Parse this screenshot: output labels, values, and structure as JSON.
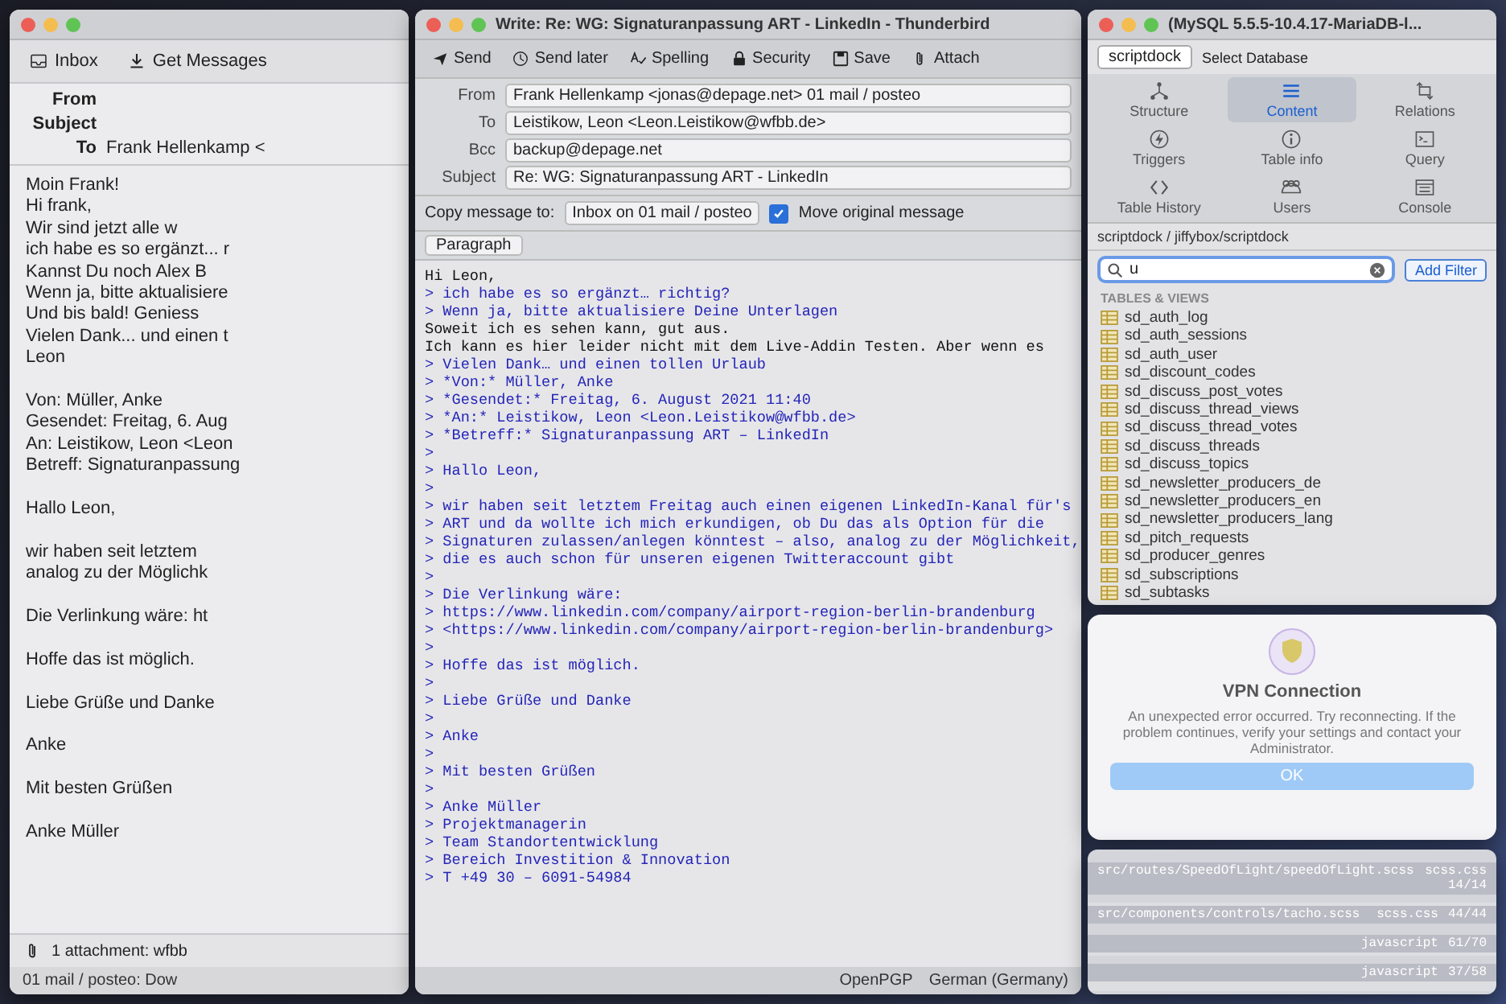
{
  "reader": {
    "toolbar": [
      {
        "label": "Inbox",
        "kind": "inbox"
      },
      {
        "label": "Get Messages",
        "kind": "get"
      }
    ],
    "headers": [
      {
        "label": "From"
      },
      {
        "label": "Subject"
      },
      {
        "label": "To",
        "value": "Frank Hellenkamp <"
      }
    ],
    "paragraphs": [
      [
        "Moin Frank!",
        "Hi frank,",
        "Wir sind jetzt alle w",
        "ich habe es so ergänzt... r",
        "Kannst Du noch Alex B",
        "Wenn ja, bitte aktualisiere",
        "Und bis bald! Geniess",
        "Vielen Dank... und einen t",
        "Leon"
      ],
      [
        "Von: Müller, Anke",
        "Gesendet: Freitag, 6. Aug",
        "An: Leistikow, Leon <Leon",
        "Betreff: Signaturanpassung"
      ],
      [
        "Hallo Leon,"
      ],
      [
        "wir haben seit letztem",
        "analog zu der Möglichk"
      ],
      [
        "Die Verlinkung wäre: ht"
      ],
      [
        "Hoffe das ist möglich."
      ],
      [
        "Liebe Grüße und Danke"
      ],
      [
        "Anke"
      ],
      [
        "Mit besten Grüßen"
      ],
      [
        "Anke Müller"
      ]
    ],
    "attachment": "1 attachment: wfbb",
    "status": "01 mail / posteo: Dow"
  },
  "compose": {
    "title": "Write: Re: WG: Signaturanpassung ART - LinkedIn - Thunderbird",
    "toolbar": [
      {
        "label": "Send",
        "kind": "send"
      },
      {
        "label": "Send later",
        "kind": "later"
      },
      {
        "label": "Spelling",
        "kind": "spelling"
      },
      {
        "label": "Security",
        "kind": "security"
      },
      {
        "label": "Save",
        "kind": "save"
      },
      {
        "label": "Attach",
        "kind": "attach"
      }
    ],
    "fields": [
      {
        "label": "From",
        "value": "Frank Hellenkamp <jonas@depage.net> 01 mail / posteo"
      },
      {
        "label": "To",
        "value": "Leistikow, Leon <Leon.Leistikow@wfbb.de>"
      },
      {
        "label": "Bcc",
        "value": "backup@depage.net"
      },
      {
        "label": "Subject",
        "value": "Re: WG: Signaturanpassung ART - LinkedIn"
      }
    ],
    "copy": {
      "label": "Copy message to:",
      "value": "Inbox on 01 mail / posteo",
      "option": "Move original message",
      "checked": true
    },
    "format": "Paragraph",
    "body": [
      {
        "kind": "text",
        "text": "Hi Leon,"
      },
      {
        "kind": "quote",
        "text": "> ich habe es so ergänzt… richtig?"
      },
      {
        "kind": "quote",
        "text": "> Wenn ja, bitte aktualisiere Deine Unterlagen"
      },
      {
        "kind": "text",
        "text": "Soweit ich es sehen kann, gut aus."
      },
      {
        "kind": "text",
        "text": "Ich kann es hier leider nicht mit dem Live-Addin Testen. Aber wenn es"
      },
      {
        "kind": "quote",
        "text": "> Vielen Dank… und einen tollen Urlaub"
      },
      {
        "kind": "quote",
        "text": "> *Von:* Müller, Anke"
      },
      {
        "kind": "quote",
        "text": "> *Gesendet:* Freitag, 6. August 2021 11:40"
      },
      {
        "kind": "quote",
        "text": "> *An:* Leistikow, Leon <Leon.Leistikow@wfbb.de>"
      },
      {
        "kind": "quote",
        "text": "> *Betreff:* Signaturanpassung ART – LinkedIn"
      },
      {
        "kind": "quote",
        "text": ">"
      },
      {
        "kind": "quote",
        "text": "> Hallo Leon,"
      },
      {
        "kind": "quote",
        "text": ">"
      },
      {
        "kind": "quote",
        "text": "> wir haben seit letztem Freitag auch einen eigenen LinkedIn-Kanal für's"
      },
      {
        "kind": "quote",
        "text": "> ART und da wollte ich mich erkundigen, ob Du das als Option für die"
      },
      {
        "kind": "quote",
        "text": "> Signaturen zulassen/anlegen könntest – also, analog zu der Möglichkeit,"
      },
      {
        "kind": "quote",
        "text": "> die es auch schon für unseren eigenen Twitteraccount gibt"
      },
      {
        "kind": "quote",
        "text": ">"
      },
      {
        "kind": "quote",
        "text": "> Die Verlinkung wäre:"
      },
      {
        "kind": "quote",
        "text": "> https://www.linkedin.com/company/airport-region-berlin-brandenburg"
      },
      {
        "kind": "quote",
        "text": "> <https://www.linkedin.com/company/airport-region-berlin-brandenburg>"
      },
      {
        "kind": "quote",
        "text": ">"
      },
      {
        "kind": "quote",
        "text": "> Hoffe das ist möglich."
      },
      {
        "kind": "quote",
        "text": ">"
      },
      {
        "kind": "quote",
        "text": "> Liebe Grüße und Danke"
      },
      {
        "kind": "quote",
        "text": ">"
      },
      {
        "kind": "quote",
        "text": "> Anke"
      },
      {
        "kind": "quote",
        "text": ">"
      },
      {
        "kind": "quote",
        "text": "> Mit besten Grüßen"
      },
      {
        "kind": "quote",
        "text": ">"
      },
      {
        "kind": "quote",
        "text": "> Anke Müller"
      },
      {
        "kind": "quote",
        "text": "> Projektmanagerin"
      },
      {
        "kind": "quote",
        "text": "> Team Standortentwicklung"
      },
      {
        "kind": "quote",
        "text": "> Bereich Investition & Innovation"
      },
      {
        "kind": "quote",
        "text": "> T +49 30 – 6091-54984"
      }
    ],
    "status": [
      "OpenPGP",
      "German (Germany)"
    ]
  },
  "sequel": {
    "title": "(MySQL 5.5.5-10.4.17-MariaDB-l...",
    "database": "scriptdock",
    "database_label": "Select Database",
    "toolbar": [
      {
        "label": "Structure",
        "kind": "structure",
        "selected": false
      },
      {
        "label": "Content",
        "kind": "content",
        "selected": true
      },
      {
        "label": "Relations",
        "kind": "relations",
        "selected": false
      },
      {
        "label": "Triggers",
        "kind": "triggers",
        "selected": false
      },
      {
        "label": "Table info",
        "kind": "info",
        "selected": false
      },
      {
        "label": "Query",
        "kind": "query",
        "selected": false
      },
      {
        "label": "Table History",
        "kind": "history",
        "selected": false
      },
      {
        "label": "Users",
        "kind": "users",
        "selected": false
      },
      {
        "label": "Console",
        "kind": "console",
        "selected": false
      }
    ],
    "path": "scriptdock / jiffybox/scriptdock",
    "search": "u",
    "filter_button": "Add Filter",
    "tables_heading": "TABLES & VIEWS",
    "tables": [
      "sd_auth_log",
      "sd_auth_sessions",
      "sd_auth_user",
      "sd_discount_codes",
      "sd_discuss_post_votes",
      "sd_discuss_thread_views",
      "sd_discuss_thread_votes",
      "sd_discuss_threads",
      "sd_discuss_topics",
      "sd_newsletter_producers_de",
      "sd_newsletter_producers_en",
      "sd_newsletter_producers_lang",
      "sd_pitch_requests",
      "sd_producer_genres",
      "sd_subscriptions",
      "sd_subtasks"
    ]
  },
  "vpn": {
    "title": "VPN Connection",
    "message": "An unexpected error occurred. Try reconnecting. If the problem continues, verify your settings and contact your Administrator.",
    "button": "OK"
  },
  "editor": {
    "status_lines": [
      {
        "path": "src/routes/SpeedOfLight/speedOfLight.scss",
        "mode": "scss.css",
        "position": "14/14"
      },
      {
        "path": "src/components/controls/tacho.scss",
        "mode": "scss.css",
        "position": "44/44"
      },
      {
        "mode": "javascript",
        "position": "61/70"
      },
      {
        "mode": "javascript",
        "position": "37/58"
      }
    ]
  }
}
